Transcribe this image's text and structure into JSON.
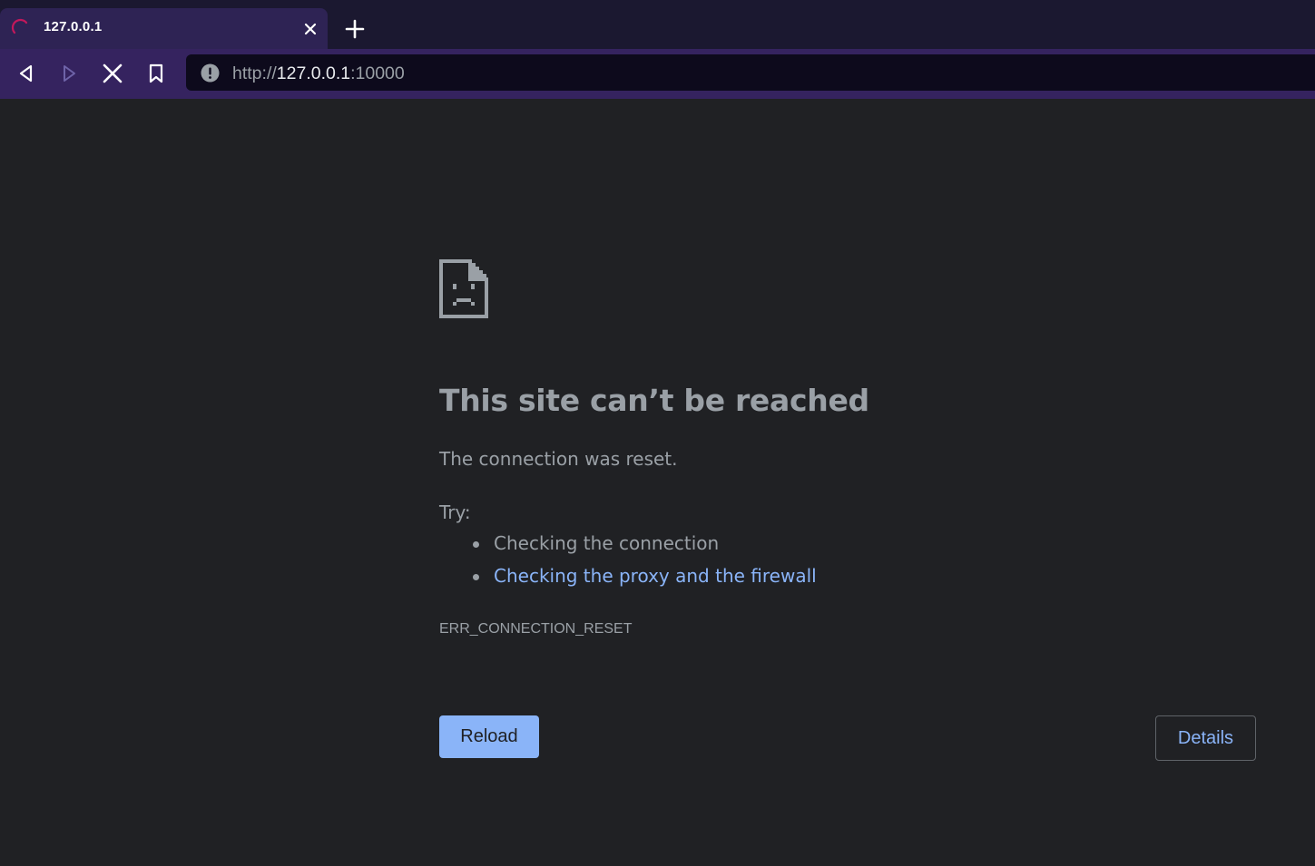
{
  "tab": {
    "title": "127.0.0.1",
    "loading": true
  },
  "toolbar": {
    "back_icon": "back-arrow-icon",
    "forward_icon": "forward-arrow-icon",
    "stop_icon": "stop-loading-icon",
    "bookmark_icon": "bookmark-icon"
  },
  "omnibox": {
    "security_icon": "not-secure-info-icon",
    "url_scheme": "http://",
    "url_host": "127.0.0.1",
    "url_port": ":10000"
  },
  "error_page": {
    "icon": "sad-document-icon",
    "heading": "This site can’t be reached",
    "subtitle": "The connection was reset.",
    "try_label": "Try:",
    "suggestions": [
      {
        "text": "Checking the connection",
        "is_link": false
      },
      {
        "text": "Checking the proxy and the firewall",
        "is_link": true
      }
    ],
    "error_code": "ERR_CONNECTION_RESET",
    "reload_label": "Reload",
    "details_label": "Details"
  },
  "colors": {
    "tab_strip": "#1b1830",
    "active_tab": "#2e2354",
    "toolbar": "#35235f",
    "omnibox": "#0d0a1c",
    "page_background": "#202124",
    "text": "#9aa0a6",
    "link": "#8ab4f8",
    "button": "#8ab4f8"
  }
}
